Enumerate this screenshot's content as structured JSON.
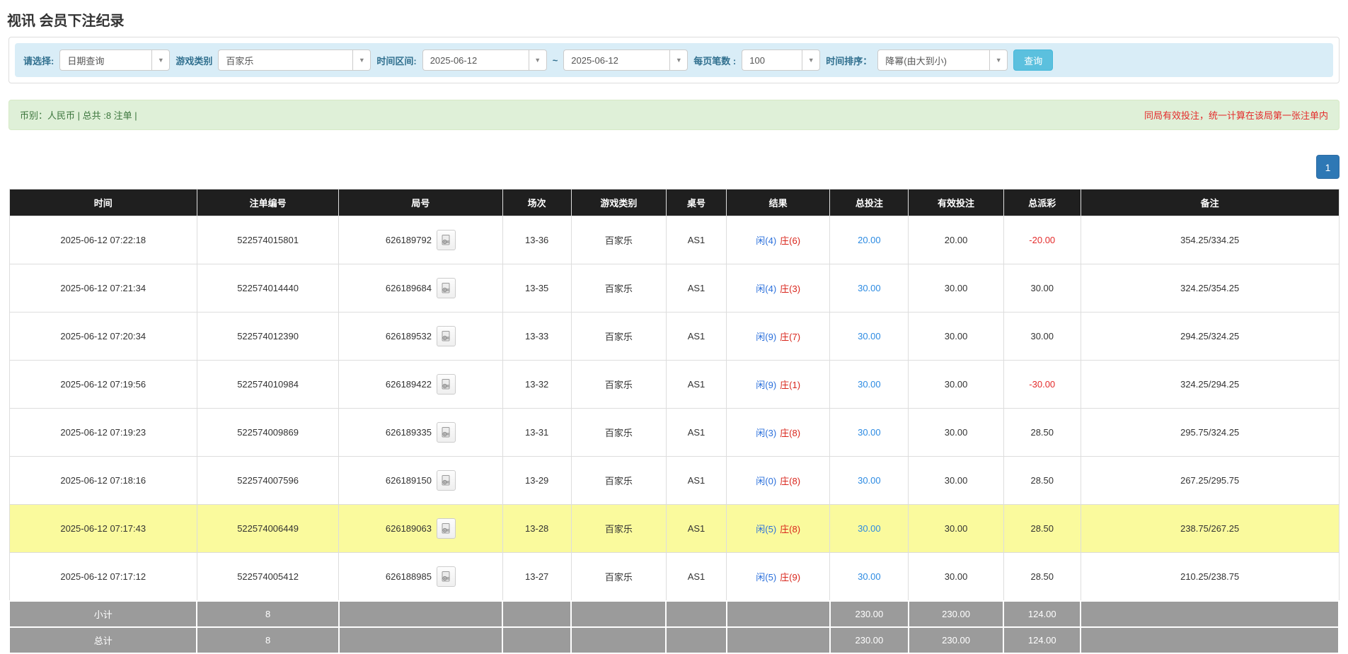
{
  "page": {
    "title": "视讯 会员下注纪录"
  },
  "filters": {
    "select_label": "请选择:",
    "select_value": "日期查询",
    "game_type_label": "游戏类别",
    "game_type_value": "百家乐",
    "date_range_label": "时间区间:",
    "date_from": "2025-06-12",
    "date_separator": "~",
    "date_to": "2025-06-12",
    "page_size_label": "每页笔数 :",
    "page_size_value": "100",
    "sort_label": "时间排序：",
    "sort_value": "降幂(由大到小)",
    "search_button": "查询"
  },
  "summary": {
    "left": "币别：人民币 | 总共 :8 注单 |",
    "right": "同局有效投注，统一计算在该局第一张注单内"
  },
  "pagination": {
    "page": "1"
  },
  "table": {
    "columns": [
      "时间",
      "注单编号",
      "局号",
      "场次",
      "游戏类别",
      "桌号",
      "结果",
      "总投注",
      "有效投注",
      "总派彩",
      "备注"
    ],
    "rows": [
      {
        "time": "2025-06-12 07:22:18",
        "bet_id": "522574015801",
        "round_id": "626189792",
        "session": "13-36",
        "game": "百家乐",
        "table_id": "AS1",
        "player": "闲(4)",
        "banker": "庄(6)",
        "total_bet": "20.00",
        "valid_bet": "20.00",
        "payout": "-20.00",
        "remark": "354.25/334.25"
      },
      {
        "time": "2025-06-12 07:21:34",
        "bet_id": "522574014440",
        "round_id": "626189684",
        "session": "13-35",
        "game": "百家乐",
        "table_id": "AS1",
        "player": "闲(4)",
        "banker": "庄(3)",
        "total_bet": "30.00",
        "valid_bet": "30.00",
        "payout": "30.00",
        "remark": "324.25/354.25"
      },
      {
        "time": "2025-06-12 07:20:34",
        "bet_id": "522574012390",
        "round_id": "626189532",
        "session": "13-33",
        "game": "百家乐",
        "table_id": "AS1",
        "player": "闲(9)",
        "banker": "庄(7)",
        "total_bet": "30.00",
        "valid_bet": "30.00",
        "payout": "30.00",
        "remark": "294.25/324.25"
      },
      {
        "time": "2025-06-12 07:19:56",
        "bet_id": "522574010984",
        "round_id": "626189422",
        "session": "13-32",
        "game": "百家乐",
        "table_id": "AS1",
        "player": "闲(9)",
        "banker": "庄(1)",
        "total_bet": "30.00",
        "valid_bet": "30.00",
        "payout": "-30.00",
        "remark": "324.25/294.25"
      },
      {
        "time": "2025-06-12 07:19:23",
        "bet_id": "522574009869",
        "round_id": "626189335",
        "session": "13-31",
        "game": "百家乐",
        "table_id": "AS1",
        "player": "闲(3)",
        "banker": "庄(8)",
        "total_bet": "30.00",
        "valid_bet": "30.00",
        "payout": "28.50",
        "remark": "295.75/324.25"
      },
      {
        "time": "2025-06-12 07:18:16",
        "bet_id": "522574007596",
        "round_id": "626189150",
        "session": "13-29",
        "game": "百家乐",
        "table_id": "AS1",
        "player": "闲(0)",
        "banker": "庄(8)",
        "total_bet": "30.00",
        "valid_bet": "30.00",
        "payout": "28.50",
        "remark": "267.25/295.75"
      },
      {
        "time": "2025-06-12 07:17:43",
        "bet_id": "522574006449",
        "round_id": "626189063",
        "session": "13-28",
        "game": "百家乐",
        "table_id": "AS1",
        "player": "闲(5)",
        "banker": "庄(8)",
        "total_bet": "30.00",
        "valid_bet": "30.00",
        "payout": "28.50",
        "remark": "238.75/267.25"
      },
      {
        "time": "2025-06-12 07:17:12",
        "bet_id": "522574005412",
        "round_id": "626188985",
        "session": "13-27",
        "game": "百家乐",
        "table_id": "AS1",
        "player": "闲(5)",
        "banker": "庄(9)",
        "total_bet": "30.00",
        "valid_bet": "30.00",
        "payout": "28.50",
        "remark": "210.25/238.75"
      }
    ],
    "subtotal": {
      "label": "小计",
      "count": "8",
      "total_bet": "230.00",
      "valid_bet": "230.00",
      "payout": "124.00"
    },
    "total": {
      "label": "总计",
      "count": "8",
      "total_bet": "230.00",
      "valid_bet": "230.00",
      "payout": "124.00"
    }
  },
  "colors": {
    "accent_button": "#5bc0de",
    "filter_bg": "#d9edf7",
    "summary_bg": "#dff0d8",
    "summary_text": "#3c763d",
    "warning_text": "#e42b2b",
    "header_bg": "#1f1f1f",
    "totals_bg": "#9b9b9b",
    "highlight_row": "#fafa9d",
    "player_blue": "#2a6fdb",
    "banker_red": "#d9261c",
    "bet_link_blue": "#2b8ae2",
    "pagination_blue": "#2e78b5"
  }
}
